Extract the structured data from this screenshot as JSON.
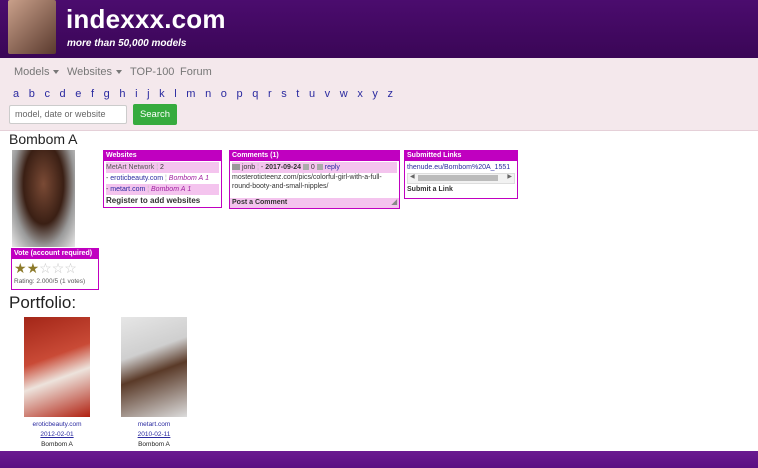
{
  "header": {
    "site_title": "indexxx.com",
    "tagline": "more than 50,000 models"
  },
  "nav": {
    "items": [
      {
        "label": "Models",
        "dropdown": true
      },
      {
        "label": "Websites",
        "dropdown": true
      },
      {
        "label": "TOP-100",
        "dropdown": false
      },
      {
        "label": "Forum",
        "dropdown": false
      }
    ],
    "letters": [
      "a",
      "b",
      "c",
      "d",
      "e",
      "f",
      "g",
      "h",
      "i",
      "j",
      "k",
      "l",
      "m",
      "n",
      "o",
      "p",
      "q",
      "r",
      "s",
      "t",
      "u",
      "v",
      "w",
      "x",
      "y",
      "z"
    ]
  },
  "search": {
    "placeholder": "model, date or website",
    "button": "Search"
  },
  "model": {
    "name": "Bombom A"
  },
  "vote": {
    "title": "Vote (account required)",
    "rating_text": "Rating: 2.000/5 (1 votes)",
    "stars_filled": 2,
    "stars_total": 5
  },
  "websites_box": {
    "title": "Websites",
    "network": "MetArt Network",
    "network_count": "2",
    "entries": [
      {
        "site": "eroticbeauty.com",
        "alias": "Bombom A",
        "count": "1"
      },
      {
        "site": "metart.com",
        "alias": "Bombom A",
        "count": "1"
      }
    ],
    "register": "Register to add websites"
  },
  "comments_box": {
    "title": "Comments (1)",
    "user": "jonb",
    "date": "2017-09-24",
    "score": "0",
    "reply": "reply",
    "text": "mosteroticteenz.com/pics/colorful-girl-with-a-full-round-booty-and-small-nipples/",
    "post": "Post a Comment"
  },
  "links_box": {
    "title": "Submitted Links",
    "url": "thenude.eu/Bombom%20A_1551",
    "submit": "Submit a Link"
  },
  "portfolio": {
    "title": "Portfolio:",
    "items": [
      {
        "site": "eroticbeauty.com",
        "date": "2012-02-01",
        "model": "Bombom A"
      },
      {
        "site": "metart.com",
        "date": "2010-02-11",
        "model": "Bombom A"
      }
    ]
  }
}
